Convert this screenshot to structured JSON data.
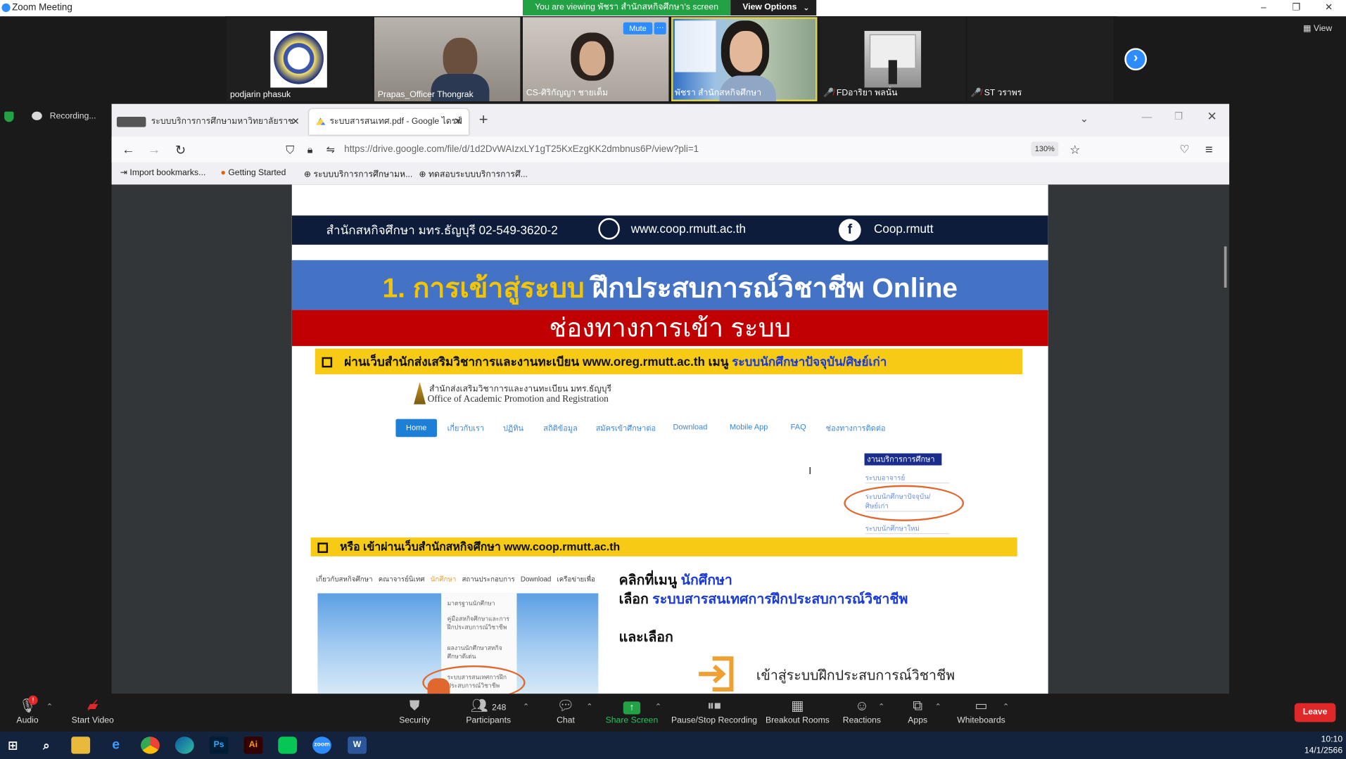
{
  "window": {
    "title": "Zoom Meeting",
    "min": "–",
    "max": "❐",
    "close": "✕"
  },
  "share_banner": {
    "text": "You are viewing พัชรา สำนักสหกิจศึกษา's screen",
    "view_options": "View Options",
    "chevron": "⌄"
  },
  "gallery": {
    "participants": [
      {
        "name": "podjarin phasuk",
        "muted": false
      },
      {
        "name": "Prapas_Officer Thongrak",
        "muted": false
      },
      {
        "name": "CS-ศิริกัญญา ชายเต็ม",
        "muted": false,
        "mute_button": "Mute",
        "more": "···"
      },
      {
        "name": "พัชรา สำนักสหกิจศึกษา",
        "muted": false,
        "active": true
      },
      {
        "name": "FDอาริยา พลนั่น",
        "muted": true
      },
      {
        "name": "ST วราพร",
        "muted": true
      }
    ],
    "next": "›",
    "view_label": "View"
  },
  "recording": {
    "label": "Recording..."
  },
  "browser": {
    "tabs": [
      {
        "title": "ระบบบริการการศึกษามหาวิทยาลัยราช",
        "active": false
      },
      {
        "title": "ระบบสารสนเทศ.pdf - Google ไดรฟ์",
        "active": true
      }
    ],
    "new_tab": "+",
    "tab_list": "⌄",
    "url": "https://drive.google.com/file/d/1d2DvWAIzxLY1gT25KxEzgKK2dmbnus6P/view?pli=1",
    "zoom": "130%",
    "bookmarks": [
      {
        "label": "Import bookmarks...",
        "icon": "import-icon"
      },
      {
        "label": "Getting Started",
        "icon": "firefox-icon"
      },
      {
        "label": "ระบบบริการการศึกษามห...",
        "icon": "globe-icon"
      },
      {
        "label": "ทดสอบระบบบริการการศึ...",
        "icon": "globe-icon"
      }
    ]
  },
  "pdf": {
    "header": {
      "office": "สำนักสหกิจศึกษา มทร.ธัญบุรี 02-549-3620-2",
      "website": "www.coop.rmutt.ac.th",
      "facebook": "Coop.rmutt",
      "fb_glyph": "f"
    },
    "banner1": {
      "number": "1. การเข้าสู่ระบบ",
      "rest": " ฝึกประสบการณ์วิชาชีพ Online"
    },
    "banner2": "ช่องทางการเข้า ระบบ",
    "bar1": {
      "prefix": "ผ่านเว็บสำนักส่งเสริมวิชาการและงานทะเบียน www.oreg.rmutt.ac.th เมนู ",
      "highlight": "ระบบนักศึกษาปัจจุบัน/ศิษย์เก่า"
    },
    "oreg": {
      "title_th": "สำนักส่งเสริมวิชาการและงานทะเบียน มทร.ธัญบุรี",
      "title_en": "Office of Academic Promotion and Registration",
      "nav": [
        "Home",
        "เกี่ยวกับเรา",
        "ปฏิทิน",
        "สถิติข้อมูล",
        "สมัครเข้าศึกษาต่อ",
        "Download",
        "Mobile App",
        "FAQ",
        "ช่องทางการติดต่อ"
      ],
      "menu_header": "งานบริการการศึกษา",
      "menu_items": [
        "ระบบอาจารย์",
        "ระบบนักศึกษาปัจจุบัน/ ศิษย์เก่า",
        "ระบบนักศึกษาใหม่"
      ]
    },
    "bar2": "หรือ เข้าผ่านเว็บสำนักสหกิจศึกษา www.coop.rmutt.ac.th",
    "coop_nav": {
      "items": [
        "เกี่ยวกับสหกิจศึกษา",
        "คณาจารย์นิเทศ",
        "นักศึกษา",
        "สถานประกอบการ",
        "Download",
        "เครือข่ายเพื่อ"
      ]
    },
    "coop_dropdown": [
      "มาตรฐานนักศึกษา",
      "คู่มือสหกิจศึกษาและการฝึกประสบการณ์วิชาชีพ",
      "ผลงานนักศึกษาสหกิจศึกษาดีเด่น",
      "ระบบสารสนเทศการฝึกประสบการณ์วิชาชีพ"
    ],
    "instr1_prefix": "คลิกที่เมนู ",
    "instr1_hl": "นักศึกษา",
    "instr2_prefix": "เลือก ",
    "instr2_hl": "ระบบสารสนเทศการฝึกประสบการณ์วิชาชีพ",
    "instr3": "และเลือก",
    "enter_text": "เข้าสู่ระบบฝึกประสบการณ์วิชาชีพ"
  },
  "controls": {
    "audio": "Audio",
    "audio_badge": "!",
    "video": "Start Video",
    "security": "Security",
    "participants": "Participants",
    "participants_count": "248",
    "chat": "Chat",
    "share": "Share Screen",
    "share_glyph": "↑",
    "pause_record": "Pause/Stop Recording",
    "breakout": "Breakout Rooms",
    "reactions": "Reactions",
    "apps": "Apps",
    "whiteboards": "Whiteboards",
    "leave": "Leave"
  },
  "taskbar": {
    "time": "10:10",
    "date": "14/1/2566",
    "ps": "Ps",
    "ai": "Ai",
    "word": "W",
    "zoom": "zoom"
  }
}
